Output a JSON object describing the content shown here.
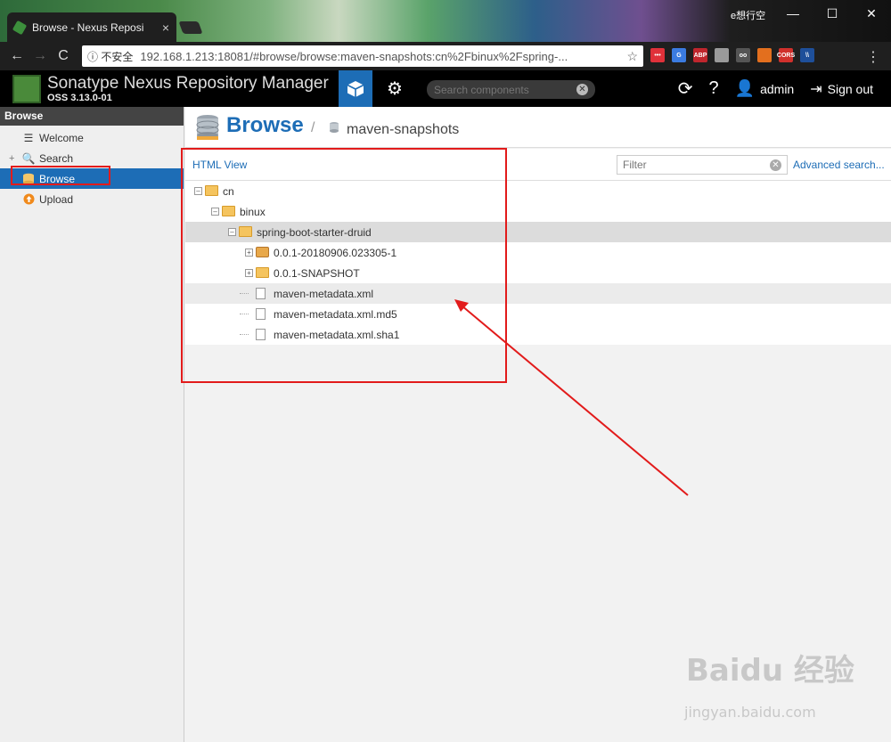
{
  "browser": {
    "tab_title": "Browse - Nexus Reposi",
    "tab_close": "×",
    "window_label": "e想行空",
    "min": "—",
    "max": "☐",
    "close": "✕",
    "back": "←",
    "forward": "→",
    "reload": "C",
    "security": "ⓘ 不安全",
    "url": "192.168.1.213:18081/#browse/browse:maven-snapshots:cn%2Fbinux%2Fspring-...",
    "star": "☆",
    "menu": "⋮",
    "extensions": [
      {
        "name": "ext-red",
        "label": "•••",
        "color": "#e0313a"
      },
      {
        "name": "ext-translate",
        "label": "G",
        "color": "#3b7be0"
      },
      {
        "name": "ext-abp",
        "label": "ABP",
        "color": "#c0262d"
      },
      {
        "name": "ext-circle",
        "label": "",
        "color": "#9a9a9a"
      },
      {
        "name": "ext-box",
        "label": "oo",
        "color": "#555555"
      },
      {
        "name": "ext-orange",
        "label": "",
        "color": "#e36f1e"
      },
      {
        "name": "ext-cors",
        "label": "CORS",
        "color": "#d0302c"
      },
      {
        "name": "ext-slash",
        "label": "\\\\",
        "color": "#1e4f9a"
      }
    ]
  },
  "header": {
    "title": "Sonatype Nexus Repository Manager",
    "version": "OSS 3.13.0-01",
    "search_placeholder": "Search components",
    "user": "admin",
    "sign_out": "Sign out",
    "colors": {
      "accent": "#1d6db6"
    }
  },
  "leftnav": {
    "header": "Browse",
    "items": [
      {
        "label": "Welcome",
        "icon": "welcome-icon"
      },
      {
        "label": "Search",
        "icon": "search-icon"
      },
      {
        "label": "Browse",
        "icon": "database-icon"
      },
      {
        "label": "Upload",
        "icon": "upload-icon"
      }
    ]
  },
  "main": {
    "title": "Browse",
    "separator": "/",
    "repo": "maven-snapshots",
    "html_view": "HTML View",
    "filter_placeholder": "Filter",
    "advanced_search": "Advanced search...",
    "tree": [
      {
        "label": "cn",
        "type": "folder",
        "depth": 0,
        "toggle": "–"
      },
      {
        "label": "binux",
        "type": "folder",
        "depth": 1,
        "toggle": "–"
      },
      {
        "label": "spring-boot-starter-druid",
        "type": "folder",
        "depth": 2,
        "toggle": "–"
      },
      {
        "label": "0.0.1-20180906.023305-1",
        "type": "component",
        "depth": 3,
        "toggle": "+"
      },
      {
        "label": "0.0.1-SNAPSHOT",
        "type": "folder",
        "depth": 3,
        "toggle": "+"
      },
      {
        "label": "maven-metadata.xml",
        "type": "file",
        "depth": 3,
        "toggle": ""
      },
      {
        "label": "maven-metadata.xml.md5",
        "type": "file",
        "depth": 3,
        "toggle": ""
      },
      {
        "label": "maven-metadata.xml.sha1",
        "type": "file",
        "depth": 3,
        "toggle": ""
      }
    ]
  },
  "watermark": {
    "brand": "Baidu 经验",
    "site": "jingyan.baidu.com"
  }
}
